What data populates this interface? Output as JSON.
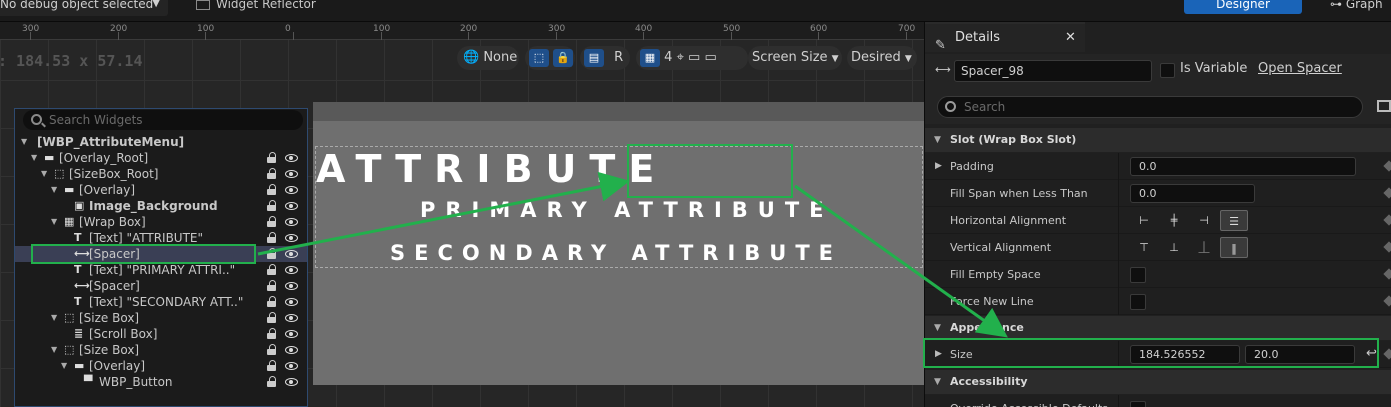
{
  "topbar": {
    "debug_select": "No debug object selected",
    "widget_reflector": "Widget Reflector",
    "designer": "Designer",
    "graph": "Graph"
  },
  "canvas": {
    "ruler_ticks": [
      "300",
      "200",
      "100",
      "0",
      "100",
      "200",
      "300",
      "400",
      "500",
      "600",
      "700"
    ],
    "dimensions": ": 184.53 x 57.14",
    "toolbar": {
      "localization": "None",
      "r_label": "R",
      "grid_value": "4",
      "screen_size": "Screen Size",
      "desired": "Desired"
    }
  },
  "preview": {
    "title": "ATTRIBUTE",
    "primary": "PRIMARY ATTRIBUTE",
    "secondary": "SECONDARY ATTRIBUTE"
  },
  "hierarchy": {
    "search_placeholder": "Search Widgets",
    "items": [
      {
        "label": "[WBP_AttributeMenu]",
        "icon": "none",
        "expand": "▼"
      },
      {
        "label": "[Overlay_Root]",
        "icon": "overlay-icon",
        "expand": "▼"
      },
      {
        "label": "[SizeBox_Root]",
        "icon": "sizebox-icon",
        "expand": "▼"
      },
      {
        "label": "[Overlay]",
        "icon": "overlay-icon",
        "expand": "▼"
      },
      {
        "label": "Image_Background",
        "icon": "image-icon",
        "expand": ""
      },
      {
        "label": "[Wrap Box]",
        "icon": "wrapbox-icon",
        "expand": "▼"
      },
      {
        "label": "[Text] \"ATTRIBUTE\"",
        "icon": "text-icon",
        "expand": ""
      },
      {
        "label": "[Spacer]",
        "icon": "spacer-icon",
        "expand": ""
      },
      {
        "label": "[Text] \"PRIMARY ATTRI..\"",
        "icon": "text-icon",
        "expand": ""
      },
      {
        "label": "[Spacer]",
        "icon": "spacer-icon",
        "expand": ""
      },
      {
        "label": "[Text] \"SECONDARY ATT..\"",
        "icon": "text-icon",
        "expand": ""
      },
      {
        "label": "[Size Box]",
        "icon": "sizebox-icon",
        "expand": "▼"
      },
      {
        "label": "[Scroll Box]",
        "icon": "scrollbox-icon",
        "expand": ""
      },
      {
        "label": "[Size Box]",
        "icon": "sizebox-icon",
        "expand": "▼"
      },
      {
        "label": "[Overlay]",
        "icon": "overlay-icon",
        "expand": "▼"
      },
      {
        "label": "WBP_Button",
        "icon": "button-icon",
        "expand": ""
      }
    ]
  },
  "details": {
    "tab_title": "Details",
    "widget_name": "Spacer_98",
    "is_variable": "Is Variable",
    "open_link": "Open Spacer",
    "search_placeholder": "Search",
    "slot_category": "Slot (Wrap Box Slot)",
    "padding_label": "Padding",
    "padding_value": "0.0",
    "fill_span_label": "Fill Span when Less Than",
    "fill_span_value": "0.0",
    "h_align_label": "Horizontal Alignment",
    "v_align_label": "Vertical Alignment",
    "fill_empty_label": "Fill Empty Space",
    "force_newline_label": "Force New Line",
    "appearance_category": "Appearance",
    "size_label": "Size",
    "size_x": "184.526552",
    "size_y": "20.0",
    "accessibility_category": "Accessibility",
    "override_label": "Override Accessible Defaults"
  },
  "colors": {
    "highlight": "#22b04c",
    "accent_blue": "#1a64b8"
  }
}
